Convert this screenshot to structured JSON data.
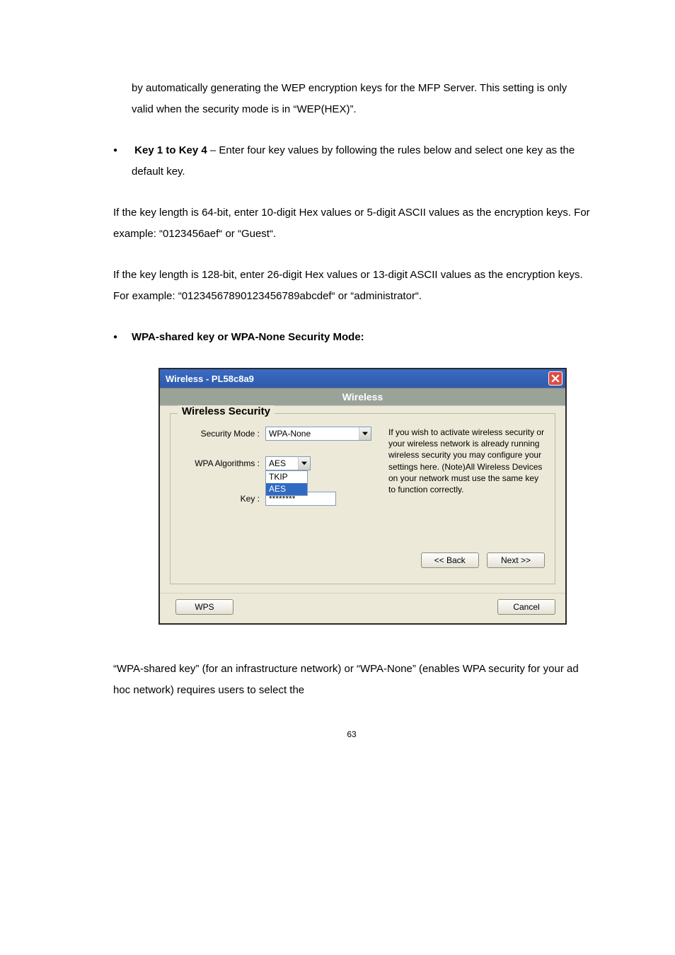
{
  "paragraphs": {
    "intro_continuation": "by automatically generating the WEP encryption keys for the MFP Server. This setting is only valid when the security mode is in “WEP(HEX)”.",
    "key1to4_label": "Key 1 to Key 4",
    "key1to4_text": " – Enter four key values by following the rules below and select one key as the default key.",
    "sixtyfour": "If the key length is 64-bit, enter 10-digit Hex values or 5-digit ASCII values as the encryption keys. For example: “0123456aef“ or “Guest“.",
    "onetwentyeight": "If the key length is 128-bit, enter 26-digit Hex values or 13-digit ASCII values as the encryption keys. For example: “01234567890123456789abcdef“ or “administrator“.",
    "wpa_heading": "WPA-shared key or WPA-None Security Mode:",
    "closing": "“WPA-shared key” (for an infrastructure network) or “WPA-None” (enables WPA security for your ad hoc network) requires users to select the"
  },
  "dialog": {
    "title": "Wireless - PL58c8a9",
    "band": "Wireless",
    "groupTitle": "Wireless Security",
    "securityModeLabel": "Security Mode :",
    "securityModeValue": "WPA-None",
    "algoLabel": "WPA Algorithms :",
    "algoValue": "AES",
    "algoOptions": [
      "TKIP",
      "AES"
    ],
    "keyLabel": "Key :",
    "keyValue": "********",
    "help": "If you wish to activate wireless security or your wireless network is already running wireless security you may configure your settings here. (Note)All Wireless Devices on your network must use the same key to function correctly.",
    "back": "<< Back",
    "next": "Next >>",
    "wps": "WPS",
    "cancel": "Cancel"
  },
  "pageNumber": "63"
}
